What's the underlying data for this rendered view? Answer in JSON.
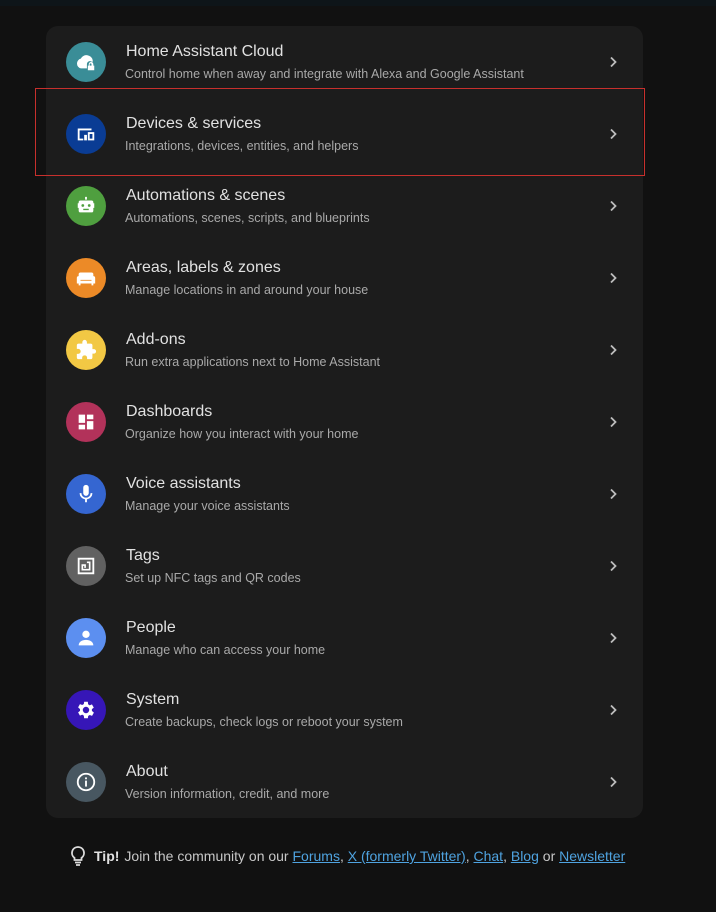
{
  "colors": {
    "background": "#111111",
    "card": "#1c1c1c",
    "highlight_border": "#c7302d",
    "link": "#4fa3e0"
  },
  "menu": {
    "items": [
      {
        "title": "Home Assistant Cloud",
        "subtitle": "Control home when away and integrate with Alexa and Google Assistant",
        "icon": "cloud-lock-icon",
        "color": "#3a8d97"
      },
      {
        "title": "Devices & services",
        "subtitle": "Integrations, devices, entities, and helpers",
        "icon": "devices-icon",
        "color": "#0a3c94"
      },
      {
        "title": "Automations & scenes",
        "subtitle": "Automations, scenes, scripts, and blueprints",
        "icon": "robot-icon",
        "color": "#4f9f3f"
      },
      {
        "title": "Areas, labels & zones",
        "subtitle": "Manage locations in and around your house",
        "icon": "sofa-icon",
        "color": "#ec8a27"
      },
      {
        "title": "Add-ons",
        "subtitle": "Run extra applications next to Home Assistant",
        "icon": "puzzle-icon",
        "color": "#f2c844"
      },
      {
        "title": "Dashboards",
        "subtitle": "Organize how you interact with your home",
        "icon": "dashboard-icon",
        "color": "#b2325a"
      },
      {
        "title": "Voice assistants",
        "subtitle": "Manage your voice assistants",
        "icon": "microphone-icon",
        "color": "#3566d1"
      },
      {
        "title": "Tags",
        "subtitle": "Set up NFC tags and QR codes",
        "icon": "nfc-tag-icon",
        "color": "#616161"
      },
      {
        "title": "People",
        "subtitle": "Manage who can access your home",
        "icon": "account-icon",
        "color": "#5c8ff0"
      },
      {
        "title": "System",
        "subtitle": "Create backups, check logs or reboot your system",
        "icon": "cog-icon",
        "color": "#3616b7"
      },
      {
        "title": "About",
        "subtitle": "Version information, credit, and more",
        "icon": "info-icon",
        "color": "#485761"
      }
    ]
  },
  "tip": {
    "label": "Tip!",
    "text": "Join the community on our",
    "links": {
      "forums": "Forums",
      "x": "X (formerly Twitter)",
      "chat": "Chat",
      "blog": "Blog",
      "newsletter": "Newsletter"
    },
    "comma": ",",
    "or": "or"
  }
}
